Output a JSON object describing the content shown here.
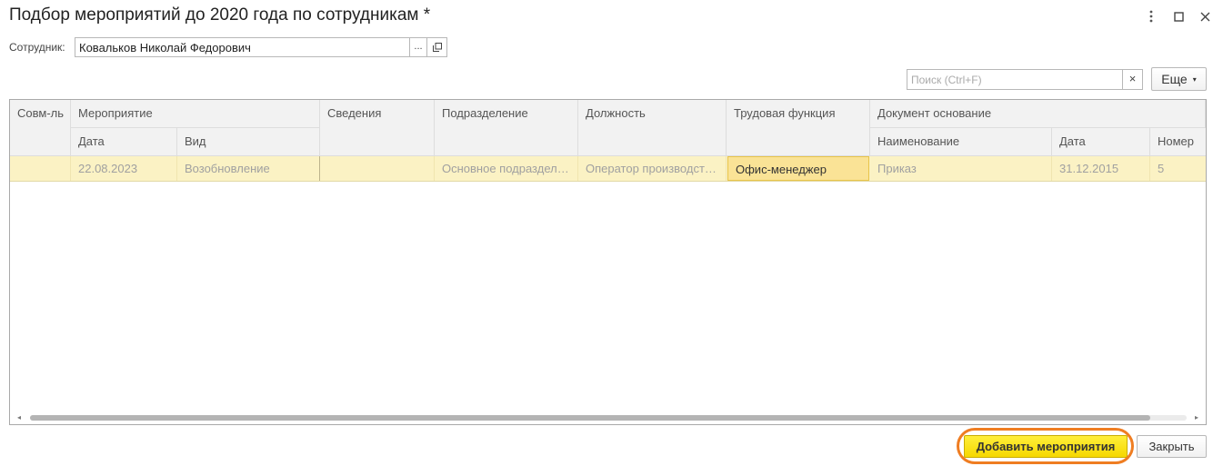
{
  "window": {
    "title": "Подбор мероприятий до 2020 года по сотрудникам *",
    "menu_icon": "kebab-menu-icon",
    "maximize_icon": "maximize-icon",
    "close_icon": "close-icon"
  },
  "employee": {
    "label": "Сотрудник:",
    "value": "Ковальков Николай Федорович",
    "choose_label": "...",
    "open_icon": "open-in-new-icon"
  },
  "search": {
    "placeholder": "Поиск (Ctrl+F)",
    "clear_label": "×"
  },
  "more_button": {
    "label": "Еще",
    "caret": "▾"
  },
  "table": {
    "headers": {
      "sovm": "Совм-ль",
      "event": "Мероприятие",
      "event_date": "Дата",
      "event_type": "Вид",
      "info": "Сведения",
      "department": "Подразделение",
      "position": "Должность",
      "labor_function": "Трудовая функция",
      "doc_basis": "Документ основание",
      "doc_name": "Наименование",
      "doc_date": "Дата",
      "doc_number": "Номер"
    },
    "rows": [
      {
        "sovm": "",
        "event_date": "22.08.2023",
        "event_type": "Возобновление",
        "info": "",
        "department": "Основное подразделение",
        "position": "Оператор производственной линии",
        "labor_function": "Офис-менеджер",
        "doc_name": "Приказ",
        "doc_date": "31.12.2015",
        "doc_number": "5"
      }
    ],
    "scroll_left": "◂",
    "scroll_right": "▸"
  },
  "buttons": {
    "add_events": "Добавить мероприятия",
    "close": "Закрыть"
  },
  "colors": {
    "primary_button": "#f6d800",
    "selected_row": "#fbf2c4",
    "highlight_ring": "#ef7d22"
  }
}
